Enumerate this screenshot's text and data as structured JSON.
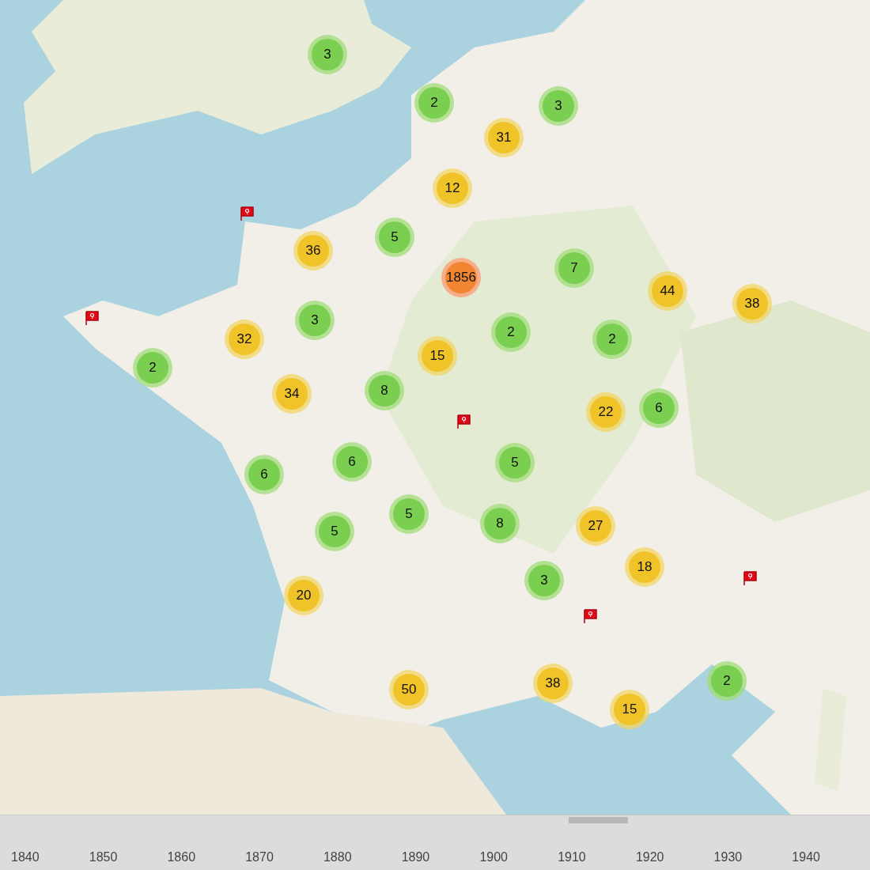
{
  "map": {
    "kind": "picture",
    "clusters": [
      {
        "count": "3",
        "kind": "small"
      },
      {
        "count": "2",
        "kind": "small"
      },
      {
        "count": "3",
        "kind": "small"
      },
      {
        "count": "31",
        "kind": "medium"
      },
      {
        "count": "12",
        "kind": "medium"
      },
      {
        "count": "5",
        "kind": "small"
      },
      {
        "count": "36",
        "kind": "medium"
      },
      {
        "count": "1856",
        "kind": "large"
      },
      {
        "count": "7",
        "kind": "small"
      },
      {
        "count": "44",
        "kind": "medium"
      },
      {
        "count": "38",
        "kind": "medium"
      },
      {
        "count": "3",
        "kind": "small"
      },
      {
        "count": "32",
        "kind": "medium"
      },
      {
        "count": "2",
        "kind": "small"
      },
      {
        "count": "2",
        "kind": "small"
      },
      {
        "count": "2",
        "kind": "small"
      },
      {
        "count": "15",
        "kind": "medium"
      },
      {
        "count": "8",
        "kind": "small"
      },
      {
        "count": "34",
        "kind": "medium"
      },
      {
        "count": "22",
        "kind": "medium"
      },
      {
        "count": "6",
        "kind": "small"
      },
      {
        "count": "6",
        "kind": "small"
      },
      {
        "count": "5",
        "kind": "small"
      },
      {
        "count": "6",
        "kind": "small"
      },
      {
        "count": "5",
        "kind": "small"
      },
      {
        "count": "8",
        "kind": "small"
      },
      {
        "count": "27",
        "kind": "medium"
      },
      {
        "count": "5",
        "kind": "small"
      },
      {
        "count": "18",
        "kind": "medium"
      },
      {
        "count": "3",
        "kind": "small"
      },
      {
        "count": "20",
        "kind": "medium"
      },
      {
        "count": "38",
        "kind": "medium"
      },
      {
        "count": "50",
        "kind": "medium"
      },
      {
        "count": "2",
        "kind": "small"
      },
      {
        "count": "15",
        "kind": "medium"
      }
    ],
    "flag_markers": [
      {
        "kind": "flag"
      },
      {
        "kind": "flag"
      },
      {
        "kind": "flag"
      },
      {
        "kind": "flag"
      },
      {
        "kind": "flag"
      }
    ]
  },
  "timeline": {
    "labels": [
      "1840",
      "1850",
      "1860",
      "1870",
      "1880",
      "1890",
      "1900",
      "1910",
      "1920",
      "1930",
      "1940"
    ]
  }
}
